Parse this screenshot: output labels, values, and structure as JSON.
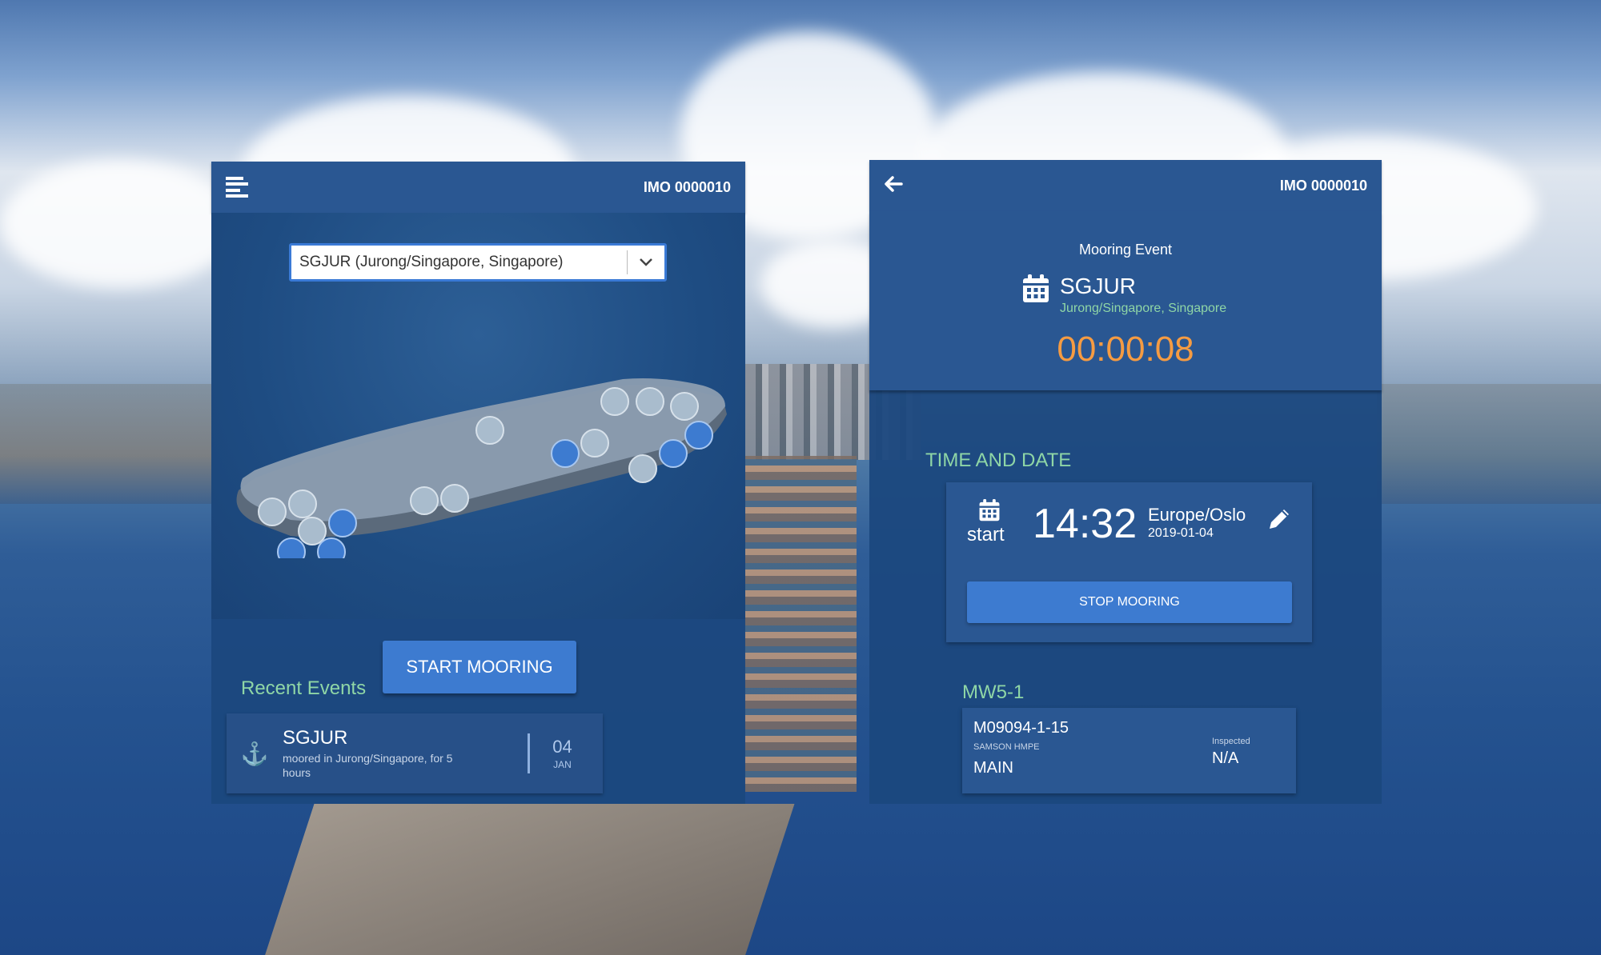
{
  "left_screen": {
    "header": {
      "imo": "IMO 0000010",
      "menu_icon": "hamburger-menu-icon"
    },
    "port_select": {
      "value": "SGJUR (Jurong/Singapore, Singapore)",
      "chevron_icon": "chevron-down-icon"
    },
    "start_button": "START MOORING",
    "recent_events": {
      "title": "Recent Events",
      "items": [
        {
          "icon": "anchor-icon",
          "code": "SGJUR",
          "description": "moored in Jurong/Singapore, for 5 hours",
          "day": "04",
          "month": "JAN"
        }
      ]
    }
  },
  "right_screen": {
    "header": {
      "imo": "IMO 0000010",
      "back_icon": "arrow-left-icon"
    },
    "mooring_event": {
      "title": "Mooring Event",
      "code": "SGJUR",
      "location": "Jurong/Singapore, Singapore",
      "timer": "00:00:08"
    },
    "time_and_date": {
      "title": "TIME AND DATE",
      "label": "start",
      "time": "14:32",
      "timezone": "Europe/Oslo",
      "date": "2019-01-04",
      "stop_button": "STOP MOORING"
    },
    "mooring_winch": {
      "title": "MW5-1",
      "line_id": "M09094-1-15",
      "line_type": "SAMSON HMPE",
      "line_role": "MAIN",
      "inspected_label": "Inspected",
      "inspected_value": "N/A"
    }
  },
  "colors": {
    "panel": "#1b487e",
    "header": "#2a5792",
    "accent_button": "#3d7bd0",
    "green_label": "#8fd6a6",
    "timer_orange": "#f59b42"
  }
}
